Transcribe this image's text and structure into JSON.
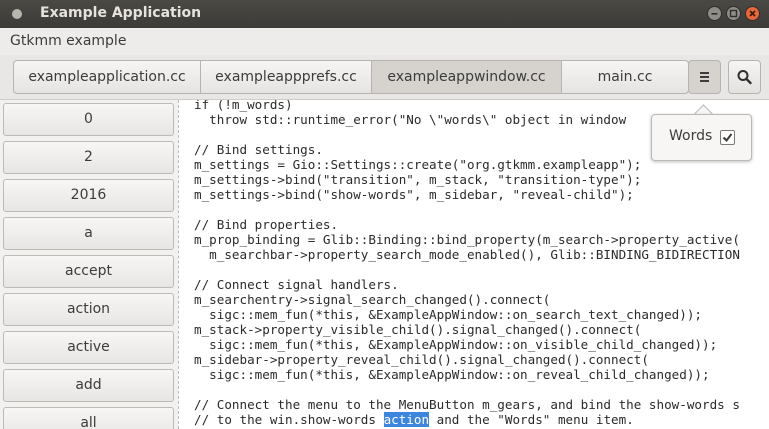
{
  "window": {
    "title": "Example Application",
    "icons": [
      "app-icon",
      "minimize-icon",
      "maximize-icon",
      "close-icon"
    ]
  },
  "menubar": {
    "label": "Gtkmm example"
  },
  "toolbar": {
    "tabs": [
      {
        "label": "exampleapplication.cc",
        "active": false
      },
      {
        "label": "exampleappprefs.cc",
        "active": false
      },
      {
        "label": "exampleappwindow.cc",
        "active": true
      },
      {
        "label": "main.cc",
        "active": false
      }
    ],
    "gears_icon": "hamburger-menu-icon",
    "search_icon": "magnifier-icon"
  },
  "sidebar": {
    "words": [
      "0",
      "2",
      "2016",
      "a",
      "accept",
      "action",
      "active",
      "add",
      "all"
    ]
  },
  "popover": {
    "label": "Words",
    "checked": true
  },
  "editor": {
    "code_lines": [
      "if (!m_words)",
      "  throw std::runtime_error(\"No \\\"words\\\" object in window",
      "",
      "// Bind settings.",
      "m_settings = Gio::Settings::create(\"org.gtkmm.exampleapp\");",
      "m_settings->bind(\"transition\", m_stack, \"transition-type\");",
      "m_settings->bind(\"show-words\", m_sidebar, \"reveal-child\");",
      "",
      "// Bind properties.",
      "m_prop_binding = Glib::Binding::bind_property(m_search->property_active(",
      "  m_searchbar->property_search_mode_enabled(), Glib::BINDING_BIDIRECTION",
      "",
      "// Connect signal handlers.",
      "m_searchentry->signal_search_changed().connect(",
      "  sigc::mem_fun(*this, &ExampleAppWindow::on_search_text_changed));",
      "m_stack->property_visible_child().signal_changed().connect(",
      "  sigc::mem_fun(*this, &ExampleAppWindow::on_visible_child_changed));",
      "m_sidebar->property_reveal_child().signal_changed().connect(",
      "  sigc::mem_fun(*this, &ExampleAppWindow::on_reveal_child_changed));",
      "",
      "// Connect the menu to the MenuButton m_gears, and bind the show-words s"
    ],
    "last_line_before": "// to the win.show-words ",
    "last_line_highlight": "action",
    "last_line_after": " and the \"Words\" menu item."
  },
  "colors": {
    "titlebar": "#3c3b37",
    "selection": "#3d86e0",
    "close_button": "#e9663b"
  }
}
